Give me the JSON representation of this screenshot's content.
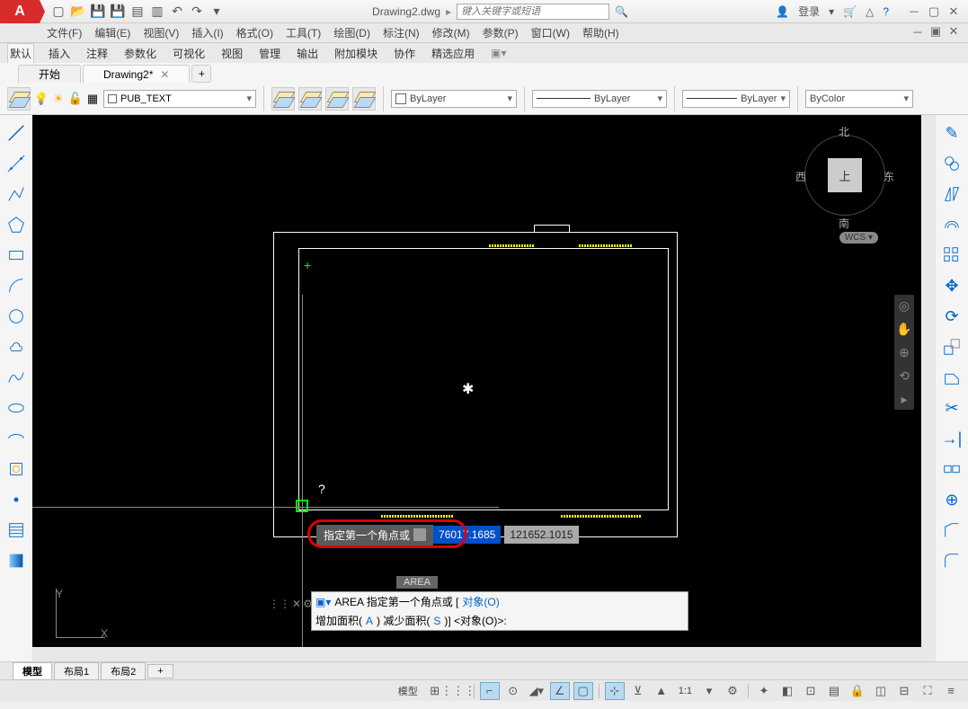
{
  "title": {
    "filename": "Drawing2.dwg",
    "search_placeholder": "键入关键字或短语",
    "login": "登录"
  },
  "menu": {
    "file": "文件(F)",
    "edit": "编辑(E)",
    "view": "视图(V)",
    "insert": "插入(I)",
    "format": "格式(O)",
    "tools": "工具(T)",
    "draw": "绘图(D)",
    "dimension": "标注(N)",
    "modify": "修改(M)",
    "parametric": "参数(P)",
    "window": "窗口(W)",
    "help": "帮助(H)"
  },
  "ribbon_tabs": {
    "default": "默认",
    "insert": "插入",
    "annotate": "注释",
    "parametric": "参数化",
    "visualize": "可视化",
    "view": "视图",
    "manage": "管理",
    "output": "输出",
    "addins": "附加模块",
    "collab": "协作",
    "featured": "精选应用"
  },
  "file_tabs": {
    "start": "开始",
    "drawing": "Drawing2*"
  },
  "layers": {
    "current": "PUB_TEXT"
  },
  "props": {
    "color": "ByLayer",
    "linetype": "ByLayer",
    "lineweight": "ByLayer",
    "plotstyle": "ByColor"
  },
  "viewcube": {
    "top": "上",
    "n": "北",
    "s": "南",
    "e": "东",
    "w": "西",
    "wcs": "WCS"
  },
  "dynamic": {
    "prompt": "指定第一个角点或",
    "x": "76017.1685",
    "y": "121652.1015",
    "question": "?"
  },
  "ucs": {
    "x": "X",
    "y": "Y"
  },
  "cmd": {
    "badge": "AREA",
    "line1_prefix": "AREA 指定第一个角点或 [",
    "line1_link": "对象(O)",
    "line2_a": "增加面积(",
    "line2_a_key": "A",
    "line2_b": ") 减少面积(",
    "line2_b_key": "S",
    "line2_c": ")] <对象(O)>:"
  },
  "layout": {
    "model": "模型",
    "layout1": "布局1",
    "layout2": "布局2"
  },
  "status": {
    "model": "模型",
    "scale": "1:1"
  },
  "app_letter": "A"
}
